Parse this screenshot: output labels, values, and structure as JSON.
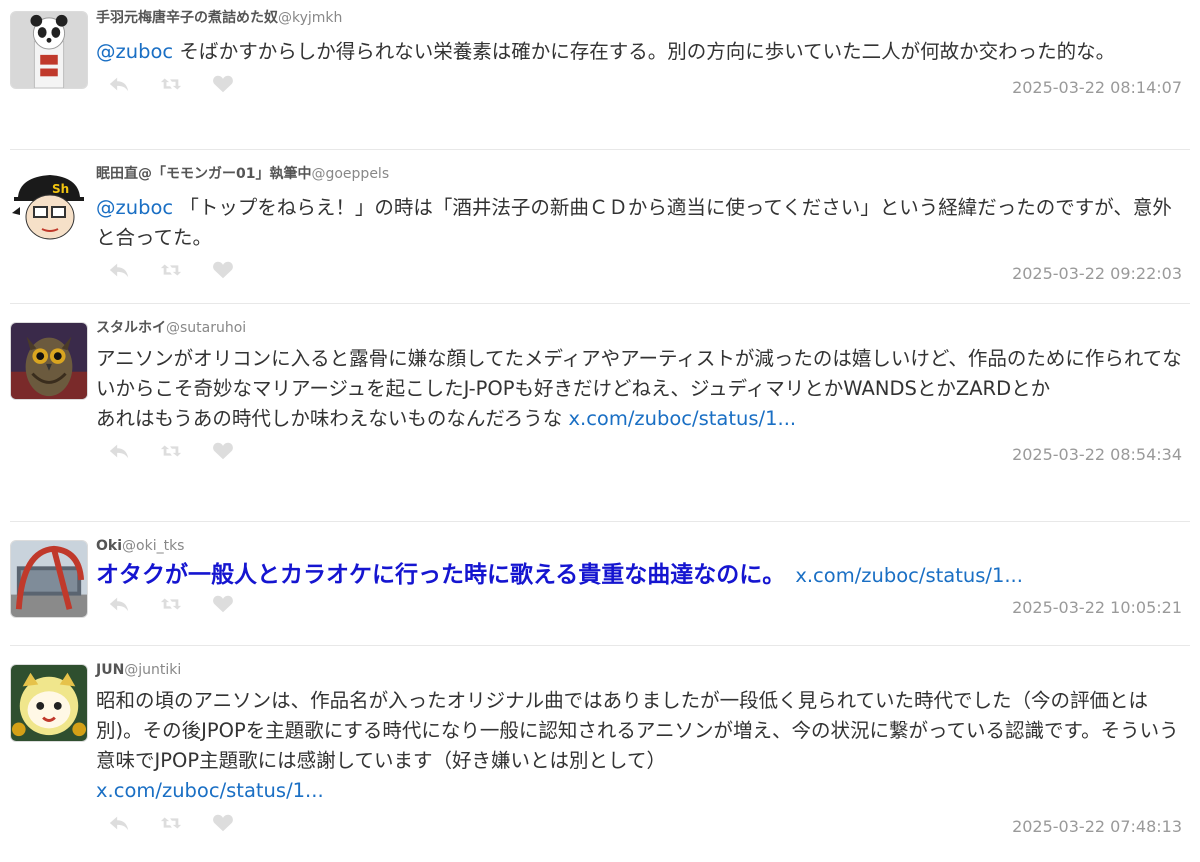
{
  "tweets": [
    {
      "name": "手羽元梅唐辛子の煮詰めた奴",
      "handle": "@kyjmkh",
      "mention": "@zuboc",
      "text": " そばかすからしか得られない栄養素は確かに存在する。別の方向に歩いていた二人が何故か交わった的な。",
      "timestamp": "2025-03-22 08:14:07",
      "avatar_icon": "panda-avatar-icon"
    },
    {
      "name": "眠田直@「モモンガー01」執筆中",
      "handle": "@goeppels",
      "mention": "@zuboc",
      "text": " 「トップをねらえ！」の時は「酒井法子の新曲ＣＤから適当に使ってください」という経緯だったのですが、意外と合ってた。",
      "timestamp": "2025-03-22 09:22:03",
      "avatar_icon": "cartoon-face-avatar-icon"
    },
    {
      "name": "スタルホイ",
      "handle": "@sutaruhoi",
      "text_lines": [
        "アニソンがオリコンに入ると露骨に嫌な顔してたメディアやアーティストが減ったのは嬉しいけど、作品のために作られてないからこそ奇妙なマリアージュを起こしたJ-POPも好きだけどねえ、ジュディマリとかWANDSとかZARDとか",
        "あれはもうあの時代しか味わえないものなんだろうな "
      ],
      "link": "x.com/zuboc/status/1...",
      "timestamp": "2025-03-22 08:54:34",
      "avatar_icon": "owl-avatar-icon"
    },
    {
      "name": "Oki",
      "handle": "@oki_tks",
      "text": "オタクが一般人とカラオケに行った時に歌える貴重な曲達なのに。",
      "link": "x.com/zuboc/status/1...",
      "timestamp": "2025-03-22 10:05:21",
      "avatar_icon": "red-arch-photo-avatar-icon"
    },
    {
      "name": "JUN",
      "handle": "@juntiki",
      "text": "昭和の頃のアニソンは、作品名が入ったオリジナル曲ではありましたが一段低く見られていた時代でした（今の評価とは別)。その後JPOPを主題歌にする時代になり一般に認知されるアニソンが増え、今の状況に繋がっている認識です。そういう意味でJPOP主題歌には感謝しています（好き嫌いとは別として）",
      "link": "x.com/zuboc/status/1...",
      "timestamp": "2025-03-22 07:48:13",
      "avatar_icon": "cat-character-avatar-icon"
    }
  ],
  "action_icons": [
    "reply-icon",
    "retweet-icon",
    "like-icon"
  ],
  "colors": {
    "link": "#1a6fc4",
    "highlight_text": "#1515d0",
    "icon_inactive": "#dddddd",
    "timestamp": "#9a9a9a"
  }
}
